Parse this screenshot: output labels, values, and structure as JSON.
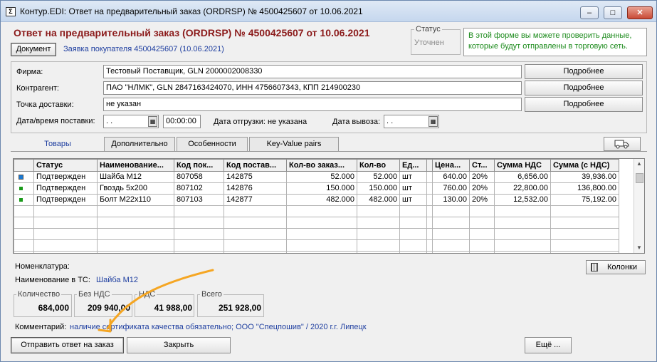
{
  "window": {
    "title": "Контур.EDI: Ответ на предварительный заказ (ORDRSP) № 4500425607 от 10.06.2021",
    "icon_glyph": "Σ",
    "controls": {
      "minimize": "–",
      "maximize": "□",
      "close": "✕"
    }
  },
  "header": {
    "title": "Ответ на предварительный заказ (ORDRSP) № 4500425607 от 10.06.2021",
    "document_button": "Документ",
    "buyer_order_link": "Заявка покупателя 4500425607 (10.06.2021)",
    "status_label": "Статус",
    "status_value": "Уточнен",
    "hint": "В этой форме вы можете проверить данные, которые будут отправлены в торговую сеть."
  },
  "parties": {
    "firm_label": "Фирма:",
    "firm_value": "Тестовый Поставщик, GLN 2000002008330",
    "contractor_label": "Контрагент:",
    "contractor_value": "ПАО \"НЛМК\", GLN 2847163424070, ИНН 4756607343, КПП 214900230",
    "delivery_point_label": "Точка доставки:",
    "delivery_point_value": "не указан",
    "details_button": "Подробнее",
    "delivery_datetime_label": "Дата/время поставки:",
    "delivery_date_value": ". .",
    "delivery_time_value": "00:00:00",
    "shipment_date_text": "Дата отгрузки: не указана",
    "pickup_date_label": "Дата вывоза:",
    "pickup_date_value": ". ."
  },
  "tabs": [
    {
      "label": "Товары",
      "active": true
    },
    {
      "label": "Дополнительно"
    },
    {
      "label": "Особенности"
    },
    {
      "label": "Key-Value pairs"
    }
  ],
  "grid": {
    "columns": [
      "",
      "Статус",
      "Наименование...",
      "Код пок...",
      "Код постав...",
      "Кол-во заказ...",
      "Кол-во",
      "Ед...",
      "",
      "Цена...",
      "Ст...",
      "Сумма НДС",
      "Сумма (с НДС)"
    ],
    "rows": [
      {
        "status": "Подтвержден",
        "name": "Шайба М12",
        "buyer_code": "807058",
        "supplier_code": "142875",
        "qty_ordered": "52.000",
        "qty": "52.000",
        "unit": "шт",
        "price": "640.00",
        "vat_rate": "20%",
        "vat_sum": "6,656.00",
        "total": "39,936.00",
        "selected": true
      },
      {
        "status": "Подтвержден",
        "name": "Гвоздь 5х200",
        "buyer_code": "807102",
        "supplier_code": "142876",
        "qty_ordered": "150.000",
        "qty": "150.000",
        "unit": "шт",
        "price": "760.00",
        "vat_rate": "20%",
        "vat_sum": "22,800.00",
        "total": "136,800.00"
      },
      {
        "status": "Подтвержден",
        "name": "Болт М22х110",
        "buyer_code": "807103",
        "supplier_code": "142877",
        "qty_ordered": "482.000",
        "qty": "482.000",
        "unit": "шт",
        "price": "130.00",
        "vat_rate": "20%",
        "vat_sum": "12,532.00",
        "total": "75,192.00"
      }
    ],
    "empty_rows": 5
  },
  "details": {
    "nomenclature_label": "Номенклатура:",
    "ts_name_label": "Наименование в ТС:",
    "ts_name_value": "Шайба М12",
    "columns_button": "Колонки"
  },
  "totals": {
    "quantity_label": "Количество",
    "quantity_value": "684,000",
    "no_vat_label": "Без НДС",
    "no_vat_value": "209 940,00",
    "vat_label": "НДС",
    "vat_value": "41 988,00",
    "total_label": "Всего",
    "total_value": "251 928,00"
  },
  "comment": {
    "label": "Комментарий:",
    "value": "наличие сертификата качества обязательно; ООО \"Спецпошив\" / 2020 г.г. Липецк"
  },
  "footer": {
    "send_button": "Отправить ответ на заказ",
    "close_button": "Закрыть",
    "more_button": "Ещё ..."
  },
  "colors": {
    "title_red": "#8b1a1a",
    "link_blue": "#1f3fa0",
    "hint_green": "#1a8a1a",
    "annotation_orange": "#f5a623"
  }
}
